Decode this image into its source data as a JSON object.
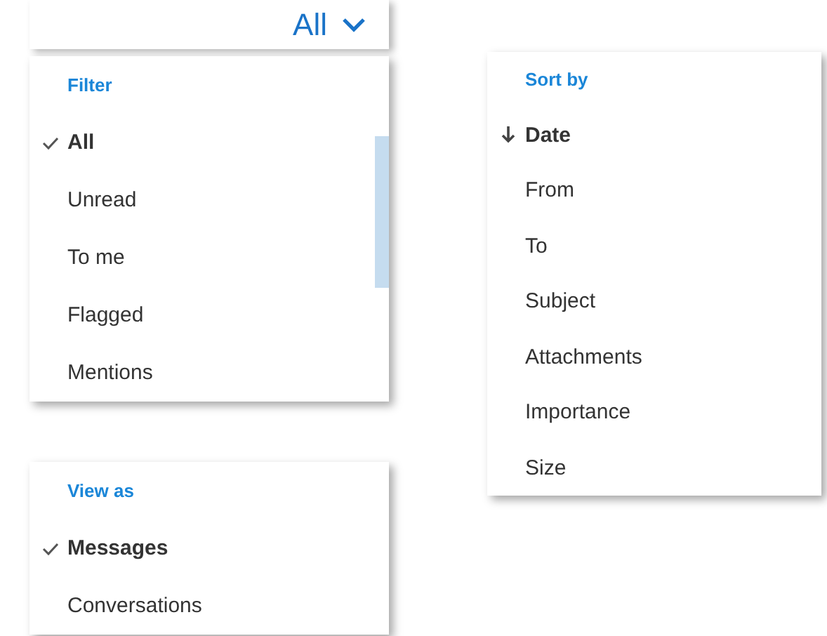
{
  "filter_button": {
    "label": "All"
  },
  "menus": [
    {
      "heading": "Filter",
      "kind": "check",
      "items": [
        {
          "label": "All",
          "selected": true
        },
        {
          "label": "Unread",
          "selected": false
        },
        {
          "label": "To me",
          "selected": false
        },
        {
          "label": "Flagged",
          "selected": false
        },
        {
          "label": "Mentions",
          "selected": false
        }
      ]
    },
    {
      "heading": "View as",
      "kind": "check",
      "items": [
        {
          "label": "Messages",
          "selected": true
        },
        {
          "label": "Conversations",
          "selected": false
        }
      ]
    },
    {
      "heading": "Sort by",
      "kind": "arrow",
      "items": [
        {
          "label": "Date",
          "selected": true
        },
        {
          "label": "From",
          "selected": false
        },
        {
          "label": "To",
          "selected": false
        },
        {
          "label": "Subject",
          "selected": false
        },
        {
          "label": "Attachments",
          "selected": false
        },
        {
          "label": "Importance",
          "selected": false
        },
        {
          "label": "Size",
          "selected": false
        }
      ]
    }
  ]
}
